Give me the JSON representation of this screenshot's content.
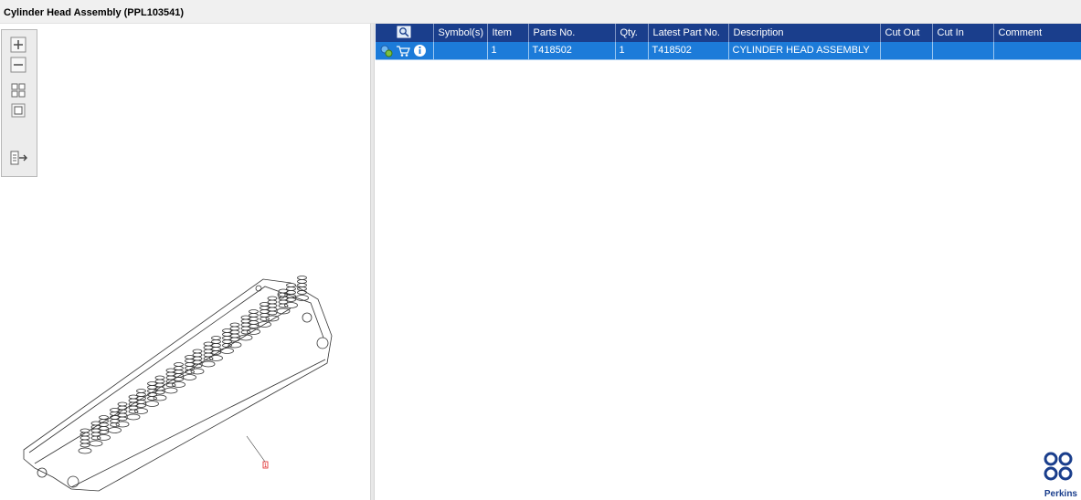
{
  "window": {
    "title": "Cylinder Head Assembly (PPL103541)"
  },
  "toolbar": {
    "buttons": [
      "zoom-in",
      "zoom-out",
      "fit-all",
      "fit-page",
      "export"
    ]
  },
  "drawing": {
    "callout": "1"
  },
  "table": {
    "columns": [
      "",
      "Symbol(s)",
      "Item",
      "Parts No.",
      "Qty.",
      "Latest Part No.",
      "Description",
      "Cut Out",
      "Cut In",
      "Comment"
    ],
    "rows": [
      {
        "symbols": "",
        "item": "1",
        "parts_no": "T418502",
        "qty": "1",
        "latest_part_no": "T418502",
        "description": "CYLINDER HEAD ASSEMBLY",
        "cut_out": "",
        "cut_in": "",
        "comment": ""
      }
    ]
  },
  "brand": {
    "name": "Perkins",
    "color": "#1a3e8c"
  },
  "colors": {
    "header_bg": "#1a3e8c",
    "selected_row_bg": "#1c7bd9"
  }
}
